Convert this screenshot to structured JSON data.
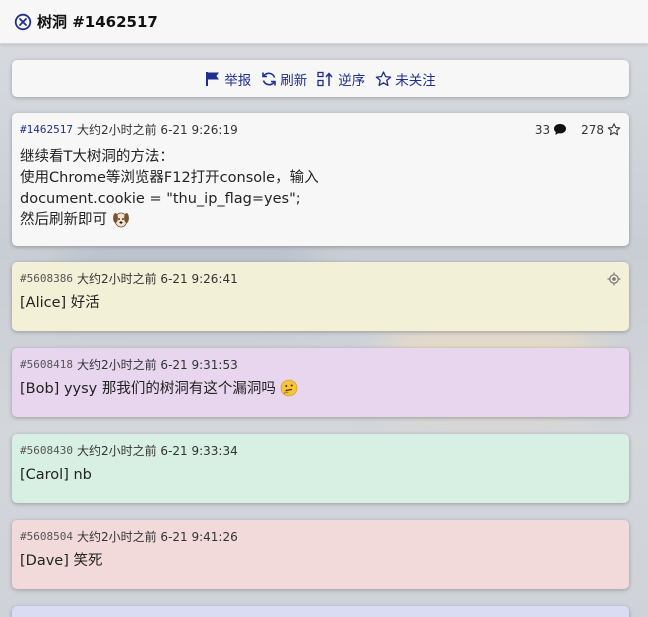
{
  "titlebar": {
    "title": "树洞 #1462517",
    "icon": "close-circle-icon"
  },
  "toolbar": {
    "report_label": "举报",
    "refresh_label": "刷新",
    "reverse_label": "逆序",
    "follow_label": "未关注"
  },
  "post": {
    "id": "#1462517",
    "time": "大约2小时之前 6-21 9:26:19",
    "reply_count": "33",
    "like_count": "278",
    "lines": [
      "继续看T大树洞的方法：",
      "使用Chrome等浏览器F12打开console，输入",
      "document.cookie = \"thu_ip_flag=yes\";",
      "然后刷新即可"
    ],
    "emoji": "dog-face"
  },
  "replies": [
    {
      "id": "#5608386",
      "time": "大约2小时之前 6-21 9:26:41",
      "text": "[Alice] 好活",
      "color": "#f2f0d7"
    },
    {
      "id": "#5608418",
      "time": "大约2小时之前 6-21 9:31:53",
      "text": "[Bob] yysy 那我们的树洞有这个漏洞吗",
      "color": "#e8d6ee",
      "emoji": "thinking-face"
    },
    {
      "id": "#5608430",
      "time": "大约2小时之前 6-21 9:33:34",
      "text": "[Carol] nb",
      "color": "#d8f0e3"
    },
    {
      "id": "#5608504",
      "time": "大约2小时之前 6-21 9:41:26",
      "text": "[Dave] 笑死",
      "color": "#f2dada"
    }
  ],
  "colors": {
    "accent": "#1f2f8f"
  }
}
